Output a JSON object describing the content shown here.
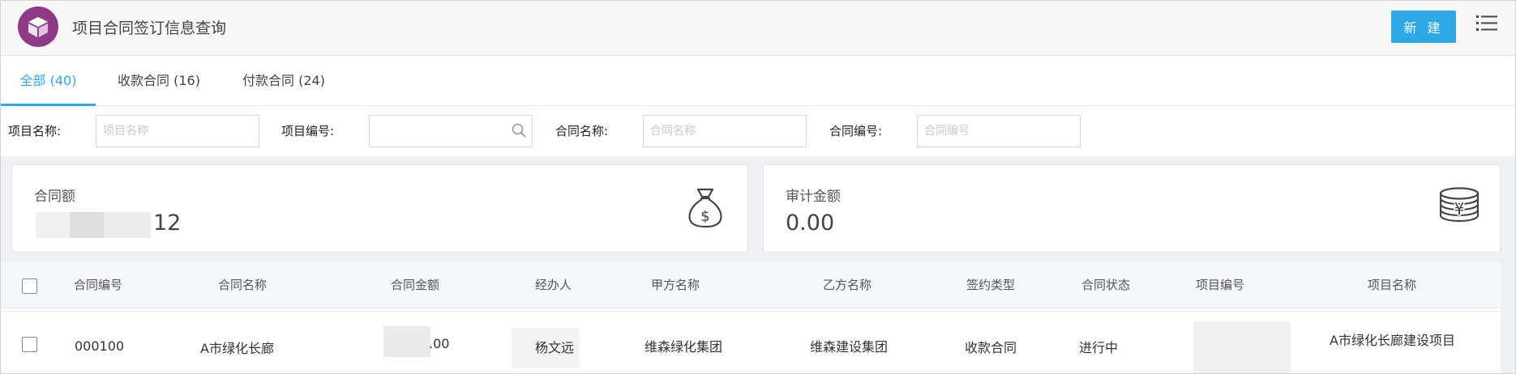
{
  "header": {
    "title": "项目合同签订信息查询",
    "new_button_label": "新 建",
    "logo_icon": "package-box-icon",
    "menu_icon": "list-menu-icon",
    "brand_color": "#8e3a86",
    "accent_color": "#2ea8e6"
  },
  "tabs": [
    {
      "label": "全部 (40)",
      "active": true
    },
    {
      "label": "收款合同 (16)",
      "active": false
    },
    {
      "label": "付款合同 (24)",
      "active": false
    }
  ],
  "filters": {
    "project_name_label": "项目名称:",
    "project_name_placeholder": "项目名称",
    "project_code_label": "项目编号:",
    "project_code_placeholder": "",
    "contract_name_label": "合同名称:",
    "contract_name_placeholder": "合同名称",
    "contract_code_label": "合同编号:",
    "contract_code_placeholder": "合同编号"
  },
  "stats": {
    "contract_amount_label": "合同额",
    "contract_amount_value_visible": "12",
    "contract_amount_icon": "money-bag-icon",
    "audit_amount_label": "审计金额",
    "audit_amount_value": "0.00",
    "audit_amount_icon": "yen-coins-icon"
  },
  "table": {
    "columns": [
      "合同编号",
      "合同名称",
      "合同金额",
      "经办人",
      "甲方名称",
      "乙方名称",
      "签约类型",
      "合同状态",
      "项目编号",
      "项目名称"
    ],
    "rows": [
      {
        "contract_code": "000100",
        "contract_name": "A市绿化长廊",
        "contract_amount_visible": ".00",
        "handler": "杨文远",
        "party_a": "维森绿化集团",
        "party_b": "维森建设集团",
        "sign_type": "收款合同",
        "status": "进行中",
        "project_code": "",
        "project_name": "A市绿化长廊建设项目"
      }
    ]
  }
}
